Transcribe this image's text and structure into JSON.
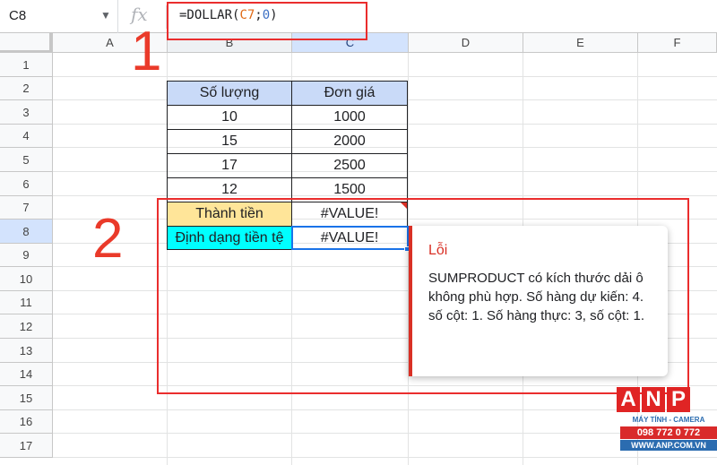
{
  "formula_bar": {
    "name_box": "C8",
    "fx": "fx",
    "formula": {
      "prefix": "=DOLLAR(",
      "ref": "C7",
      "sep": ";",
      "arg": "0",
      "suffix": ")"
    }
  },
  "columns": [
    "A",
    "B",
    "C",
    "D",
    "E",
    "F"
  ],
  "rows": [
    "1",
    "2",
    "3",
    "4",
    "5",
    "6",
    "7",
    "8",
    "9",
    "10",
    "11",
    "12",
    "13",
    "14",
    "15",
    "16",
    "17"
  ],
  "table": {
    "headers": [
      "Số lượng",
      "Đơn giá"
    ],
    "data": [
      [
        "10",
        "1000"
      ],
      [
        "15",
        "2000"
      ],
      [
        "17",
        "2500"
      ],
      [
        "12",
        "1500"
      ]
    ],
    "total_label": "Thành tiền",
    "total_value": "#VALUE!",
    "format_label": "Định dạng tiền tệ",
    "format_value": "#VALUE!"
  },
  "error_popup": {
    "title": "Lỗi",
    "message": "SUMPRODUCT có kích thước dải ô không phù hợp. Số hàng dự kiến: 4. số cột: 1. Số hàng thực: 3, số cột: 1."
  },
  "annotations": {
    "one": "1",
    "two": "2"
  },
  "watermark": {
    "letters": [
      "A",
      "N",
      "P"
    ],
    "tagline": "MÁY TÍNH - CAMERA",
    "phone": "098 772 0 772",
    "url": "WWW.ANP.COM.VN"
  },
  "colors": {
    "header_fill": "#c9daf8",
    "total_fill": "#ffe599",
    "format_fill": "#00ffff",
    "selection": "#1a73e8",
    "annotation": "#ea2d2d",
    "error": "#d93025"
  }
}
